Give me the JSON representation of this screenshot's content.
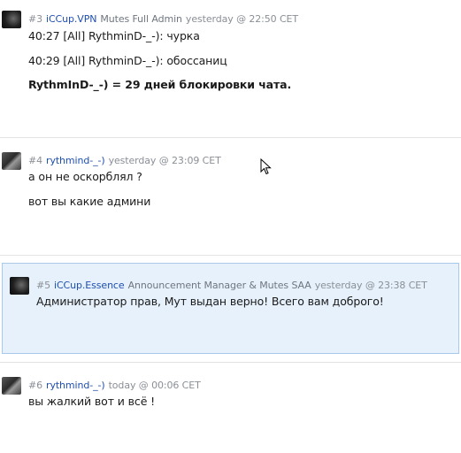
{
  "posts": [
    {
      "num": "#3",
      "user": "iCCup.VPN",
      "role": "Mutes Full Admin",
      "time": "yesterday @ 22:50 CET",
      "lines": [
        "40:27 [All] RythminD-_-): чурка",
        "40:29 [All] RythminD-_-): обоссаниц",
        "RythmInD-_-) = 29 дней блокировки чата."
      ]
    },
    {
      "num": "#4",
      "user": "rythmind-_-)",
      "role": "",
      "time": "yesterday @ 23:09 CET",
      "lines": [
        "а он не оскорблял ?",
        "вот вы какие админи"
      ]
    },
    {
      "num": "#5",
      "user": "iCCup.Essence",
      "role": "Announcement Manager & Mutes SAA",
      "time": "yesterday @ 23:38 CET",
      "lines": [
        "Администратор прав, Мут выдан верно! Всего вам доброго!"
      ]
    },
    {
      "num": "#6",
      "user": "rythmind-_-)",
      "role": "",
      "time": "today @ 00:06 CET",
      "lines": [
        "вы жалкий вот и всё !"
      ]
    }
  ]
}
